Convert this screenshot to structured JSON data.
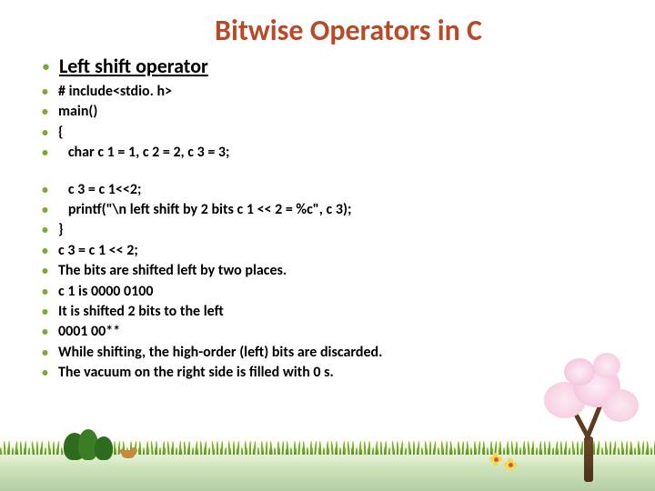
{
  "title": "Bitwise Operators in C",
  "heading": "Left shift operator",
  "group1": [
    "# include<stdio. h>",
    "main()",
    "{",
    "   char c 1 = 1, c 2 = 2, c 3 = 3;"
  ],
  "group2": [
    "   c 3 = c 1<<2;",
    "   printf(\"\\n left shift by 2 bits c 1 << 2 = %c\", c 3);",
    "}",
    "c 3 = c 1 << 2;",
    "The bits are shifted left by two places.",
    "c 1 is 0000 0100",
    "It is shifted 2 bits to the left",
    "0001 00**",
    "While shifting, the high-order (left) bits are discarded.",
    "The vacuum on the right side is filled with 0 s."
  ]
}
